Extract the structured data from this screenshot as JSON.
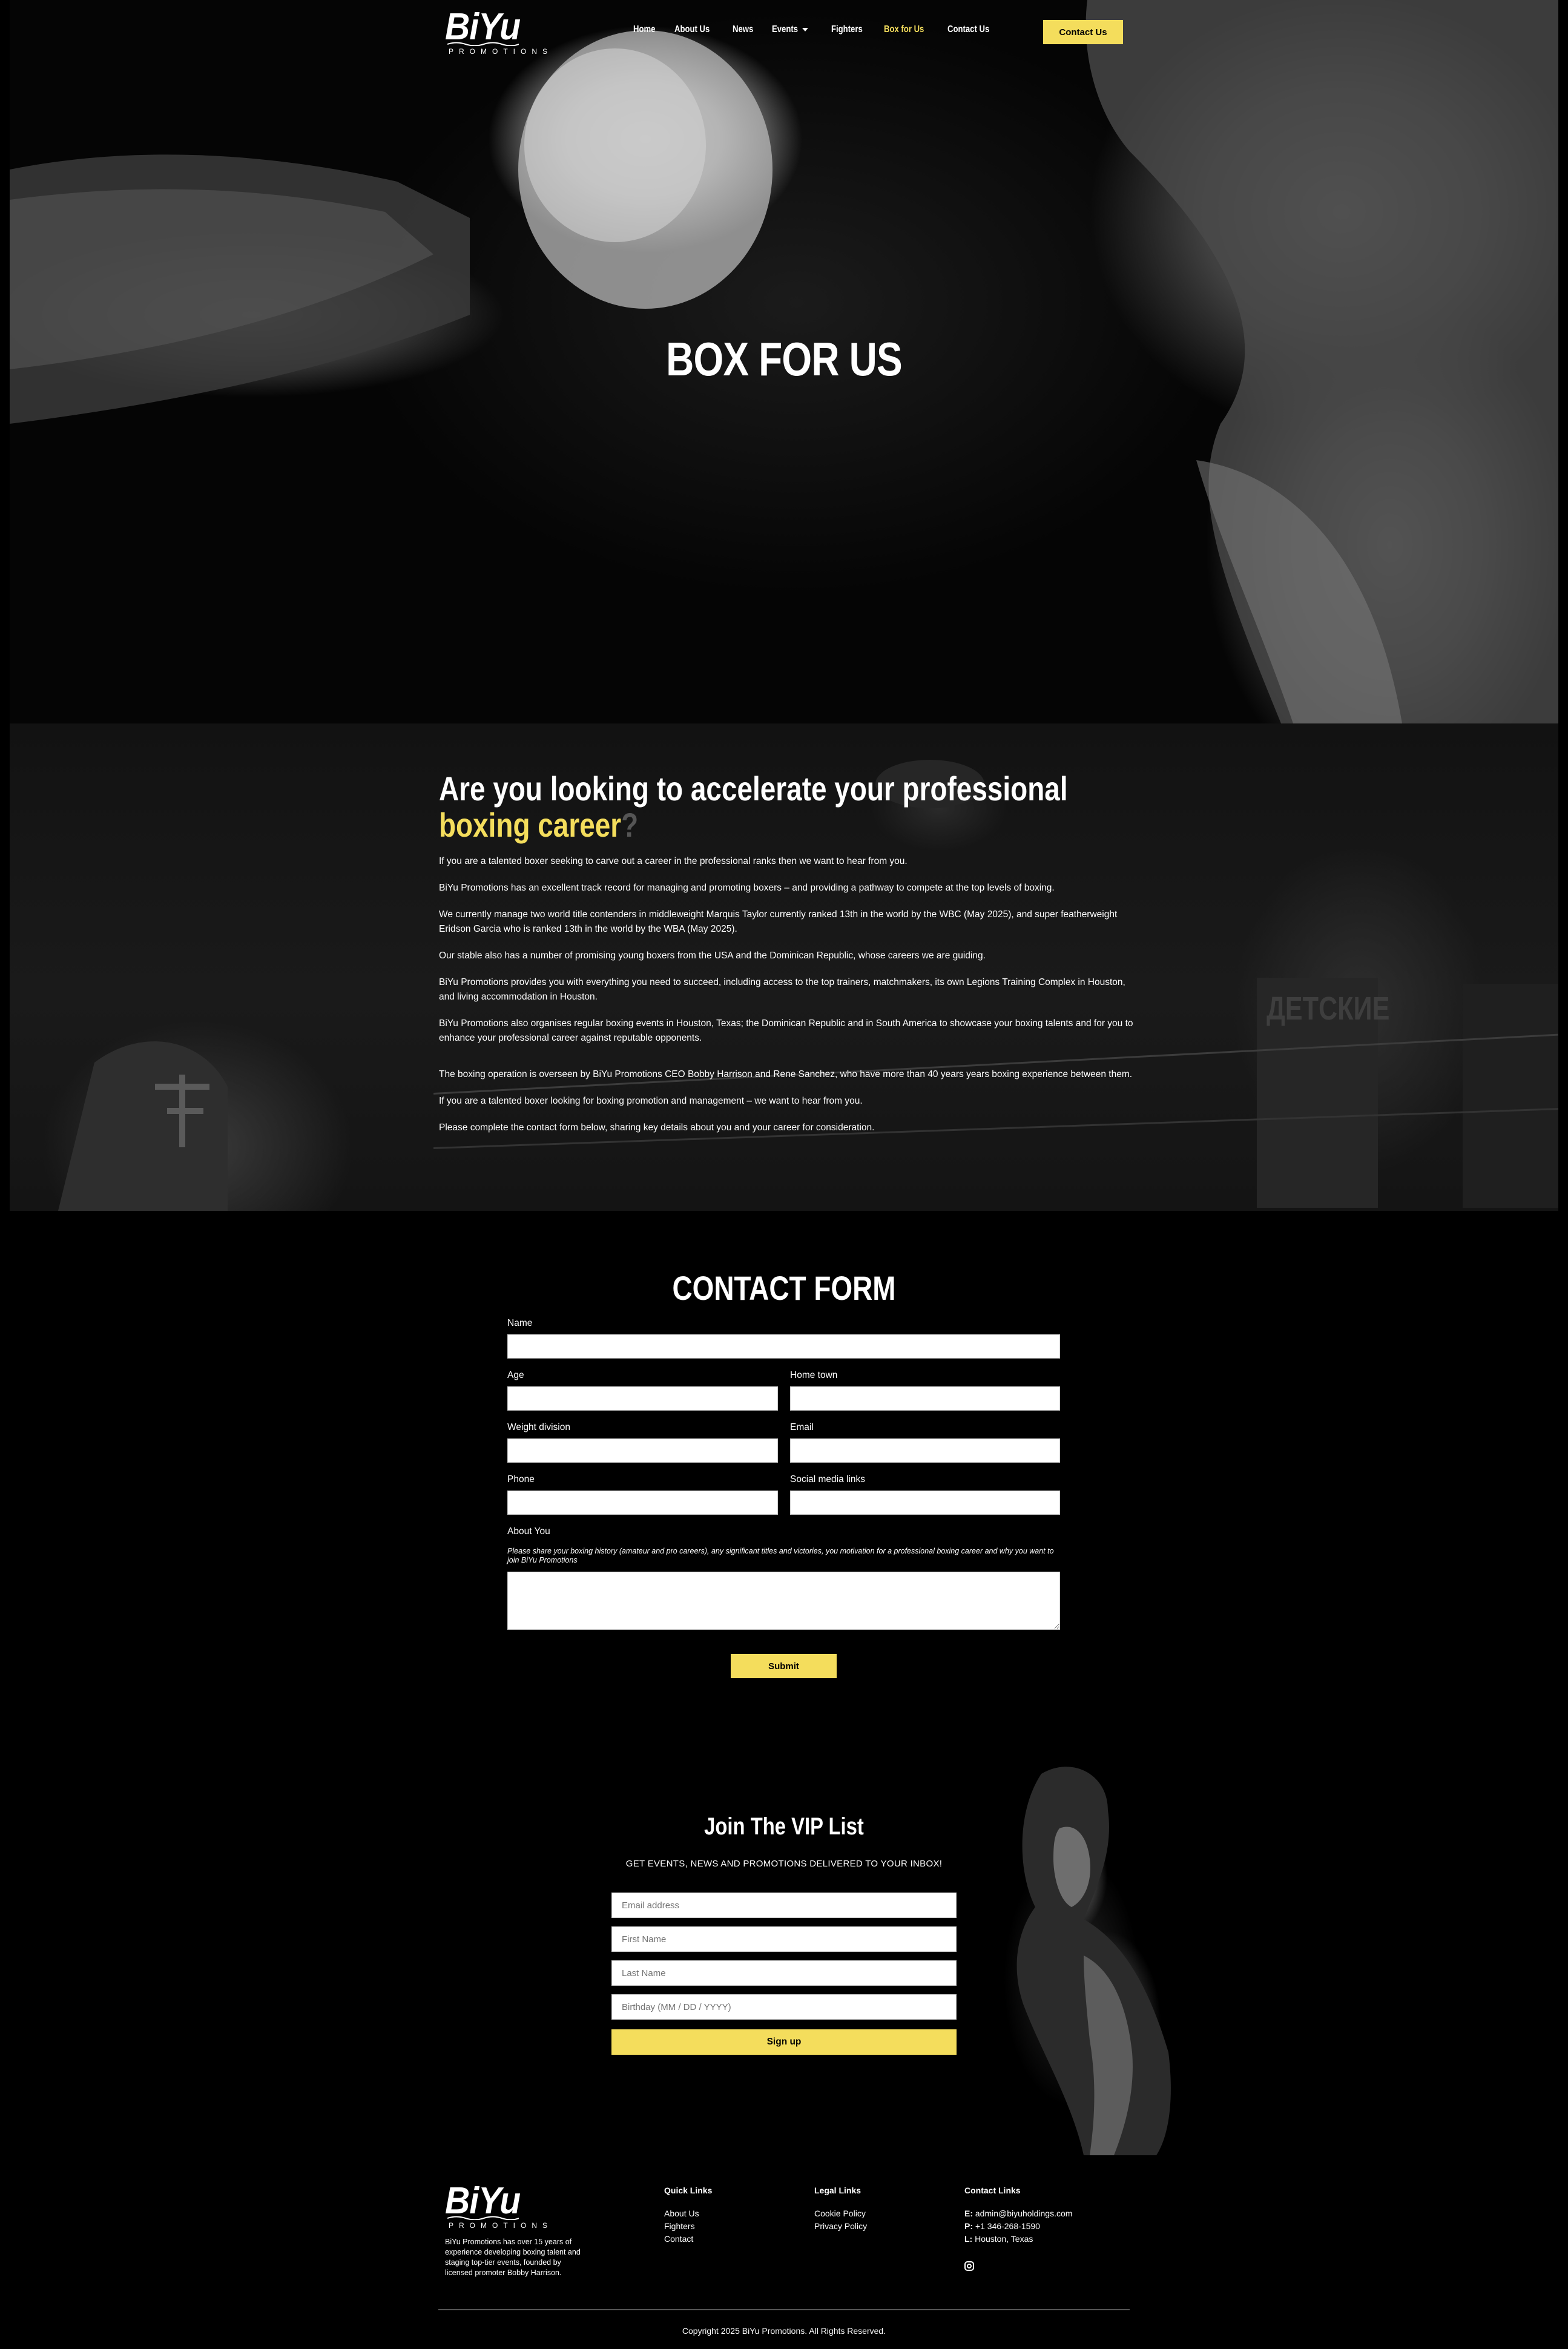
{
  "brand": {
    "logo_text": "BiYu",
    "logo_subtext": "PROMOTIONS"
  },
  "nav": {
    "items": [
      {
        "label": "Home"
      },
      {
        "label": "About Us"
      },
      {
        "label": "News"
      },
      {
        "label": "Events",
        "has_dropdown": true
      },
      {
        "label": "Fighters"
      },
      {
        "label": "Box for Us",
        "active": true
      },
      {
        "label": "Contact Us"
      }
    ],
    "cta_label": "Contact Us"
  },
  "hero": {
    "title": "BOX FOR US"
  },
  "about": {
    "title_line1": "Are you looking to accelerate your professional",
    "title_highlight": "boxing career",
    "title_end": "?",
    "paragraphs": [
      "If you are a talented boxer seeking to carve out a career in the professional ranks then we want to hear from you.",
      "BiYu Promotions has an excellent track record for managing and promoting boxers – and providing a pathway to compete at the top levels of boxing.",
      "We currently manage two world title contenders in middleweight Marquis Taylor currently ranked 13th in the world by the WBC (May 2025), and super featherweight Eridson Garcia who is ranked 13th in the world by the WBA (May 2025).",
      "Our stable also has a number of promising young boxers from the USA and the Dominican Republic, whose careers we are guiding.",
      "BiYu Promotions provides you with everything you need to succeed, including access to the top trainers, matchmakers, its own Legions Training Complex in Houston, and living accommodation in Houston.",
      "BiYu Promotions also organises regular boxing events in Houston, Texas; the Dominican Republic and in South America to showcase your boxing talents and for you to enhance your professional career against reputable opponents.",
      "The boxing operation is overseen by BiYu Promotions CEO Bobby Harrison and Rene Sanchez, who have more than 40 years years boxing experience between them.",
      "If you are a talented boxer looking for boxing promotion and management – we want to hear from you.",
      "Please complete the contact form below, sharing key details about you and your career for consideration."
    ],
    "background_sign": "ДЕТСКИЕ"
  },
  "contact_form": {
    "title": "CONTACT FORM",
    "fields": {
      "name": {
        "label": "Name",
        "value": ""
      },
      "age": {
        "label": "Age",
        "value": ""
      },
      "home_town": {
        "label": "Home town",
        "value": ""
      },
      "weight_division": {
        "label": "Weight division",
        "value": ""
      },
      "email": {
        "label": "Email",
        "value": ""
      },
      "phone": {
        "label": "Phone",
        "value": ""
      },
      "social": {
        "label": "Social media links",
        "value": ""
      },
      "about": {
        "label": "About You",
        "help": "Please share your boxing history (amateur and pro careers), any significant titles and victories, you motivation for a professional boxing career and why you want to join BiYu Promotions",
        "value": ""
      }
    },
    "submit_label": "Submit"
  },
  "vip": {
    "title": "Join The VIP List",
    "subtitle": "GET EVENTS, NEWS AND PROMOTIONS DELIVERED TO YOUR INBOX!",
    "placeholders": {
      "email": "Email address",
      "first_name": "First Name",
      "last_name": "Last Name",
      "birthday": "Birthday (MM / DD / YYYY)"
    },
    "button_label": "Sign up"
  },
  "footer": {
    "about_text": "BiYu Promotions has over 15 years of experience developing boxing talent and staging top-tier events, founded by licensed promoter Bobby Harrison.",
    "quick_links": {
      "title": "Quick Links",
      "items": [
        "About Us",
        "Fighters",
        "Contact"
      ]
    },
    "legal_links": {
      "title": "Legal Links",
      "items": [
        "Cookie Policy",
        "Privacy Policy"
      ]
    },
    "contact": {
      "title": "Contact Links",
      "email_prefix": "E:",
      "email": "admin@biyuholdings.com",
      "phone_prefix": "P:",
      "phone": "+1 346-268-1590",
      "location_prefix": "L:",
      "location": "Houston, Texas"
    },
    "copyright": "Copyright 2025 BiYu Promotions. All Rights Reserved."
  },
  "colors": {
    "accent": "#f4dd5c",
    "background": "#000000",
    "text": "#ffffff"
  },
  "icons": {
    "social": "instagram-icon",
    "dropdown": "caret-down-icon"
  }
}
